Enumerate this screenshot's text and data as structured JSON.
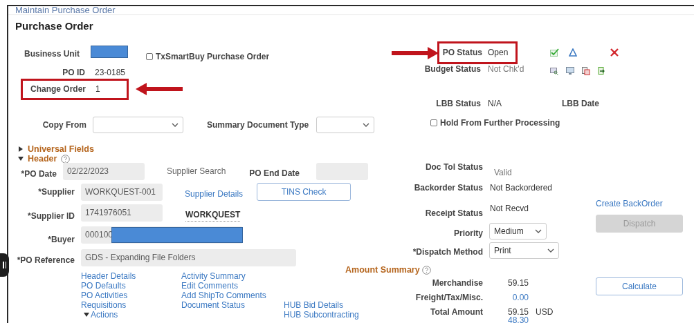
{
  "breadcrumb": "Maintain Purchase Order",
  "title": "Purchase Order",
  "business_unit": {
    "label": "Business Unit"
  },
  "txsmartbuy": {
    "label": "TxSmartBuy Purchase Order",
    "checked": false
  },
  "po_id": {
    "label": "PO ID",
    "value": "23-0185"
  },
  "change_order": {
    "label": "Change Order",
    "value": "1"
  },
  "po_status": {
    "label": "PO Status",
    "value": "Open"
  },
  "budget_status": {
    "label": "Budget Status",
    "value": "Not Chk'd"
  },
  "lbb_status": {
    "label": "LBB Status",
    "value": "N/A"
  },
  "lbb_date": {
    "label": "LBB Date"
  },
  "copy_from": {
    "label": "Copy From"
  },
  "summary_document_type": {
    "label": "Summary Document Type"
  },
  "hold": {
    "label": "Hold From Further Processing",
    "checked": false
  },
  "sections": [
    {
      "label": "Universal Fields",
      "expanded": false,
      "help": false
    },
    {
      "label": "Header",
      "expanded": true,
      "help": true
    }
  ],
  "header_fields": [
    {
      "label": "*PO Date",
      "value": "02/22/2023"
    },
    {
      "label": "*Supplier",
      "value": "WORKQUEST-001"
    },
    {
      "label": "*Supplier ID",
      "value": "1741976051"
    },
    {
      "label": "*Buyer",
      "value": "000100"
    },
    {
      "label": "*PO Reference",
      "value": "GDS - Expanding File Folders"
    }
  ],
  "supplier_search": "Supplier Search",
  "supplier_details": "Supplier Details",
  "supplier_name": "WORKQUEST",
  "po_end_date": {
    "label": "PO End Date"
  },
  "buttons": [
    {
      "label": "TINS Check",
      "disabled": false
    },
    {
      "label": "Dispatch",
      "disabled": true
    },
    {
      "label": "Calculate",
      "disabled": false
    }
  ],
  "statuses": [
    {
      "label": "Doc Tol Status",
      "value": "Valid"
    },
    {
      "label": "Backorder Status",
      "value": "Not Backordered"
    },
    {
      "label": "Receipt Status",
      "value": "Not Recvd"
    }
  ],
  "priority": {
    "label": "Priority",
    "value": "Medium"
  },
  "dispatch_method": {
    "label": "*Dispatch Method",
    "value": "Print"
  },
  "create_backorder": "Create BackOrder",
  "amount_summary": {
    "title": "Amount Summary",
    "rows": [
      {
        "label": "Merchandise",
        "value": "59.15",
        "link": false
      },
      {
        "label": "Freight/Tax/Misc.",
        "value": "0.00",
        "link": true
      },
      {
        "label": "Total Amount",
        "value": "59.15",
        "currency": "USD",
        "link": false
      }
    ],
    "extra": "48.30"
  },
  "links": [
    [
      "Header Details",
      "PO Defaults",
      "PO Activities",
      "Requisitions"
    ],
    [
      "Activity Summary",
      "Edit Comments",
      "Add ShipTo Comments",
      "Document Status"
    ],
    [
      "HUB Bid Details",
      "HUB Subcontracting"
    ]
  ],
  "actions": {
    "label": "Actions",
    "expanded": true
  }
}
